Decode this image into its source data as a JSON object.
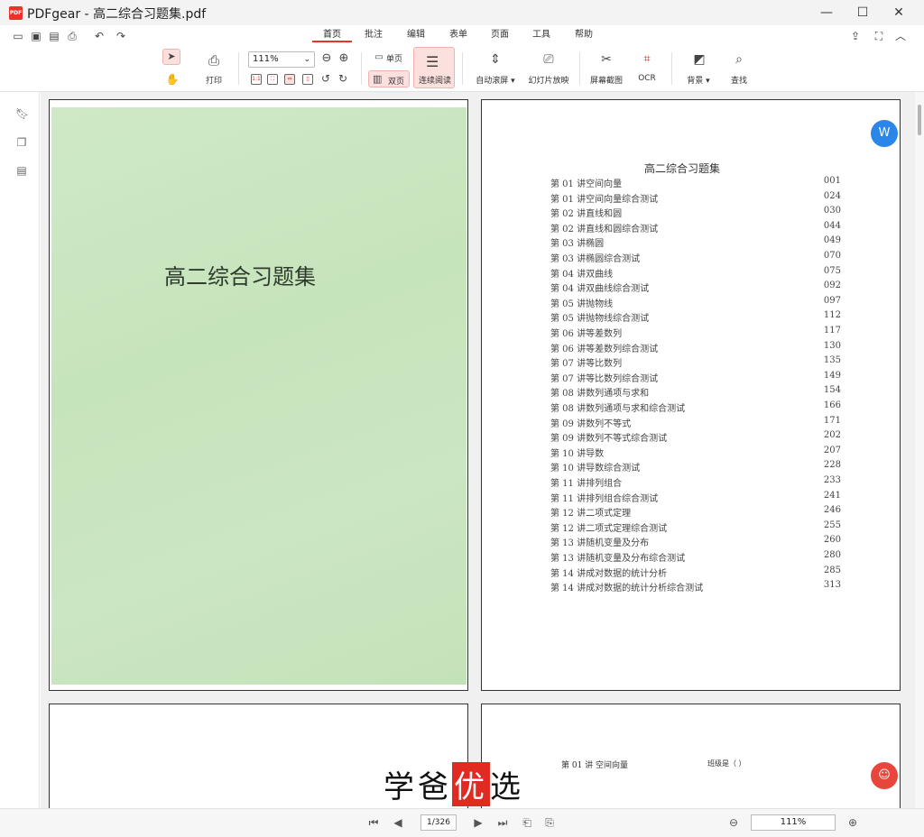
{
  "window": {
    "app_logo": "PDF",
    "title": "PDFgear - 高二综合习题集.pdf",
    "minimize": "—",
    "maximize": "☐",
    "close": "✕"
  },
  "quick_icons": [
    "open-icon",
    "save-icon",
    "save-as-icon",
    "print-icon",
    "undo-icon",
    "redo-icon"
  ],
  "menu_tabs": [
    "首页",
    "批注",
    "编辑",
    "表单",
    "页面",
    "工具",
    "帮助"
  ],
  "active_tab": "首页",
  "toolbar": {
    "print_label": "打印",
    "zoom_value": "111%",
    "single_page_label": "单页",
    "double_page_label": "双页",
    "continuous_label": "连续阅读",
    "auto_scroll_label": "自动滚屏",
    "slideshow_label": "幻灯片放映",
    "screenshot_label": "屏幕截图",
    "ocr_label": "OCR",
    "background_label": "背景",
    "find_label": "查找"
  },
  "document": {
    "cover_title": "高二综合习题集",
    "toc_title": "高二综合习题集",
    "toc": [
      {
        "title": "第 01 讲空间向量",
        "page": "001"
      },
      {
        "title": "第 01 讲空间向量综合测试",
        "page": "024"
      },
      {
        "title": "第 02 讲直线和圆",
        "page": "030"
      },
      {
        "title": "第 02 讲直线和圆综合测试",
        "page": "044"
      },
      {
        "title": "第 03 讲椭圆",
        "page": "049"
      },
      {
        "title": "第 03 讲椭圆综合测试",
        "page": "070"
      },
      {
        "title": "第 04 讲双曲线",
        "page": "075"
      },
      {
        "title": "第 04 讲双曲线综合测试",
        "page": "092"
      },
      {
        "title": "第 05 讲抛物线",
        "page": "097"
      },
      {
        "title": "第 05 讲抛物线综合测试",
        "page": "112"
      },
      {
        "title": "第 06 讲等差数列",
        "page": "117"
      },
      {
        "title": "第 06 讲等差数列综合测试",
        "page": "130"
      },
      {
        "title": "第 07 讲等比数列",
        "page": "135"
      },
      {
        "title": "第 07 讲等比数列综合测试",
        "page": "149"
      },
      {
        "title": "第 08 讲数列通项与求和",
        "page": "154"
      },
      {
        "title": "第 08 讲数列通项与求和综合测试",
        "page": "166"
      },
      {
        "title": "第 09 讲数列不等式",
        "page": "171"
      },
      {
        "title": "第 09 讲数列不等式综合测试",
        "page": "202"
      },
      {
        "title": "第 10 讲导数",
        "page": "207"
      },
      {
        "title": "第 10 讲导数综合测试",
        "page": "228"
      },
      {
        "title": "第 11 讲排列组合",
        "page": "233"
      },
      {
        "title": "第 11 讲排列组合综合测试",
        "page": "241"
      },
      {
        "title": "第 12 讲二项式定理",
        "page": "246"
      },
      {
        "title": "第 12 讲二项式定理综合测试",
        "page": "255"
      },
      {
        "title": "第 13 讲随机变量及分布",
        "page": "260"
      },
      {
        "title": "第 13 讲随机变量及分布综合测试",
        "page": "280"
      },
      {
        "title": "第 14 讲成对数据的统计分析",
        "page": "285"
      },
      {
        "title": "第 14 讲成对数据的统计分析综合测试",
        "page": "313"
      }
    ],
    "page4_heading": "第 01 讲    空间向量",
    "page4_score": "班级是（    ）"
  },
  "watermark": {
    "left": "学爸",
    "mid": "优",
    "right": "选"
  },
  "status": {
    "page_current": "1",
    "page_total": "/326",
    "zoom": "111%",
    "zoom_out": "⊖",
    "zoom_in": "⊕"
  },
  "colors": {
    "accent": "#e8322b",
    "cover": "#c9e5c0",
    "fab_blue": "#2a86e8",
    "fab_red": "#e8453c"
  }
}
